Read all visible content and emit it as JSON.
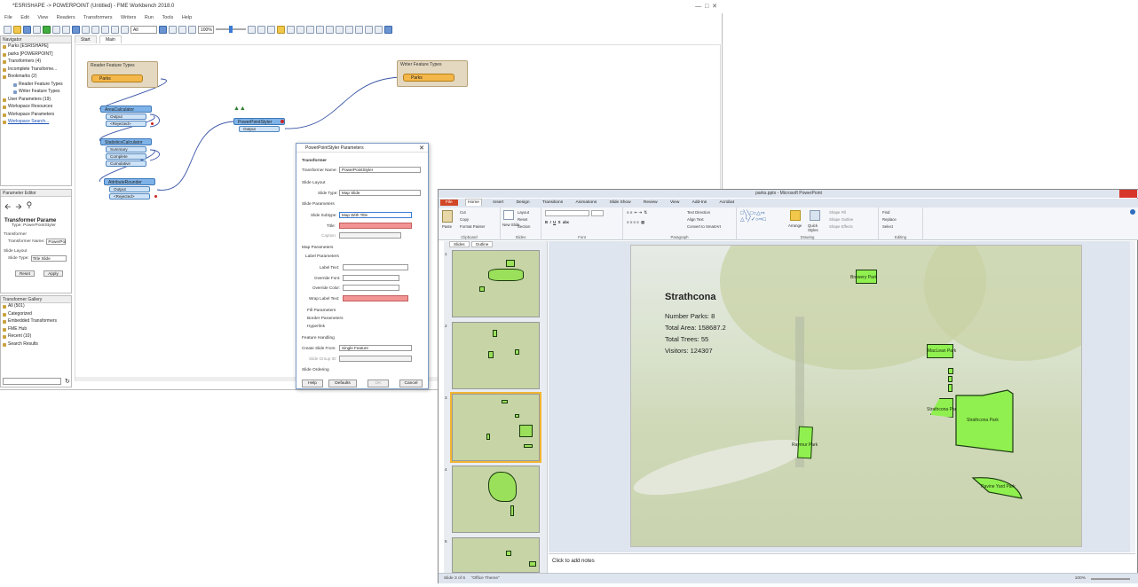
{
  "fme": {
    "title": "*ESRISHAPE -> POWERPOINT (Untitled) - FME Workbench 2018.0",
    "menu": [
      "File",
      "Edit",
      "View",
      "Readers",
      "Transformers",
      "Writers",
      "Run",
      "Tools",
      "Help"
    ],
    "zoom": "100%",
    "dropdown_all": "All",
    "tabs": [
      "Start",
      "Main"
    ],
    "navigator": {
      "title": "Navigator",
      "items": [
        {
          "label": "Parks [ESRISHAPE]",
          "level": 1
        },
        {
          "label": "parks [POWERPOINT]",
          "level": 1
        },
        {
          "label": "Transformers (4)",
          "level": 1
        },
        {
          "label": "Incomplete Transforme...",
          "level": 1
        },
        {
          "label": "Bookmarks (2)",
          "level": 1
        },
        {
          "label": "Reader Feature Types",
          "level": 2
        },
        {
          "label": "Writer Feature Types",
          "level": 2
        },
        {
          "label": "User Parameters (19)",
          "level": 1
        },
        {
          "label": "Workspace Resources",
          "level": 1
        },
        {
          "label": "Workspace Parameters",
          "level": 1
        }
      ],
      "search_link": "Workspace Search..."
    },
    "parameter_editor": {
      "title": "Parameter Editor",
      "transformer_heading": "Transformer Parame",
      "type": "Type: PowerPointStyler",
      "section_transformer": "Transformer",
      "name_label": "Transformer Name:",
      "name_value": "PowerPoi",
      "section_layout": "Slide Layout",
      "slide_type_label": "Slide Type:",
      "slide_type_value": "Title Slide",
      "reset": "Reset",
      "apply": "Apply"
    },
    "gallery": {
      "title": "Transformer Gallery",
      "items": [
        "All (501)",
        "Categorized",
        "Embedded Transformers",
        "FME Hub",
        "Recent (10)",
        "Search Results"
      ]
    },
    "canvas": {
      "reader_bookmark": "Reader Feature Types",
      "writer_bookmark": "Writer Feature Types",
      "reader_ft": "Parks",
      "writer_ft": "Parks",
      "area_calc": "AreaCalculator",
      "area_ports": [
        "Output",
        "<Rejected>"
      ],
      "stats_calc": "StatisticsCalculator",
      "stats_ports": [
        "Summary",
        "Complete",
        "Cumulative"
      ],
      "attr_rounder": "AttributeRounder",
      "attr_ports": [
        "Output",
        "<Rejected>"
      ],
      "ppt_styler": "PowerPointStyler",
      "ppt_ports": [
        "Output"
      ]
    },
    "dialog": {
      "title": "PowerPointStyler Parameters",
      "section_transformer": "Transformer",
      "name_label": "Transformer Name:",
      "name_value": "PowerPointStyler",
      "section_layout": "Slide Layout",
      "slide_type_label": "Slide Type:",
      "slide_type_value": "Map Slide",
      "section_params": "Slide Parameters",
      "subtype_label": "Slide Subtype:",
      "subtype_value": "Map With Title",
      "title_label": "Title:",
      "caption_label": "Caption:",
      "section_map": "Map Parameters",
      "label_params": "Label Parameters",
      "label_text": "Label Text:",
      "override_font": "Override Font:",
      "override_color": "Override Color:",
      "wrap_label": "Wrap Label Text:",
      "fill_params": "Fill Parameters",
      "border_params": "Border Parameters",
      "hyperlink": "Hyperlink",
      "feature_handling": "Feature Handling",
      "create_from_label": "Create Slide From:",
      "create_from_value": "Single Feature",
      "group_id_label": "Slide Group ID:",
      "slide_ordering": "Slide Ordering",
      "help": "Help",
      "defaults": "Defaults",
      "ok": "OK",
      "cancel": "Cancel"
    }
  },
  "ppt": {
    "title": "parks.pptx - Microsoft PowerPoint",
    "tabs": [
      "File",
      "Home",
      "Insert",
      "Design",
      "Transitions",
      "Animations",
      "Slide Show",
      "Review",
      "View",
      "Add-Ins",
      "Acrobat"
    ],
    "ribbon": {
      "paste": "Paste",
      "cut": "Cut",
      "copy": "Copy",
      "format_painter": "Format Painter",
      "clipboard": "Clipboard",
      "new_slide": "New Slide",
      "layout": "Layout",
      "reset": "Reset",
      "section": "Section",
      "slides": "Slides",
      "font": "Font",
      "paragraph": "Paragraph",
      "text_direction": "Text Direction",
      "align_text": "Align Text",
      "convert_smartart": "Convert to SmartArt",
      "drawing": "Drawing",
      "arrange": "Arrange",
      "quick_styles": "Quick Styles",
      "shape_fill": "Shape Fill",
      "shape_outline": "Shape Outline",
      "shape_effects": "Shape Effects",
      "find": "Find",
      "replace": "Replace",
      "select": "Select",
      "editing": "Editing"
    },
    "panel_tabs": [
      "Slides",
      "Outline"
    ],
    "slide_numbers": [
      "1",
      "2",
      "3",
      "4",
      "5"
    ],
    "slide": {
      "title": "Strathcona",
      "lines": [
        "Number Parks: 8",
        "Total Area: 158687.2",
        "Total Trees: 55",
        "Visitors: 124307"
      ],
      "parks": [
        "Brewery Park",
        "MacLean Park",
        "Strathcona Park",
        "Strathcona Park",
        "Raymur Park",
        "Ravine Yard Park"
      ]
    },
    "notes_placeholder": "Click to add notes",
    "status": {
      "slide": "Slide 3 of 6",
      "theme": "\"Office Theme\"",
      "zoom": "100%"
    }
  }
}
